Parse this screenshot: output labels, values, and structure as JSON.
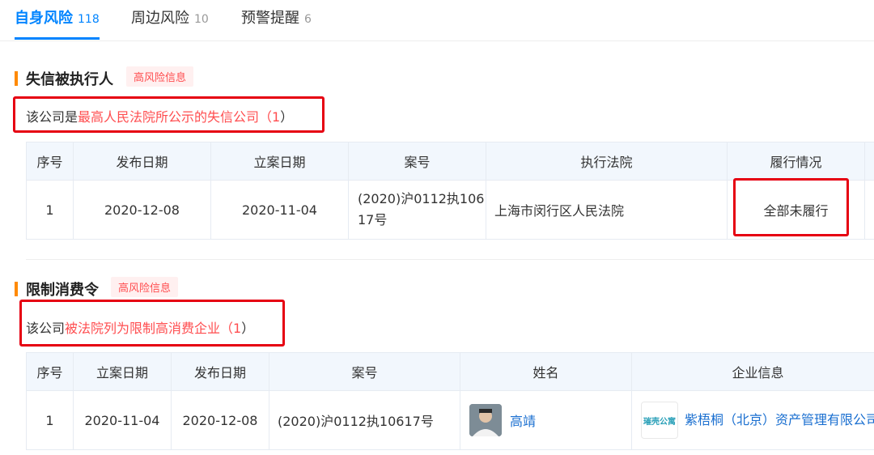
{
  "tabs": [
    {
      "label": "自身风险",
      "count": "118"
    },
    {
      "label": "周边风险",
      "count": "10"
    },
    {
      "label": "预警提醒",
      "count": "6"
    }
  ],
  "section1": {
    "title": "失信被执行人",
    "badge": "高风险信息",
    "intro_prefix": "该公司是",
    "intro_highlight": "最高人民法院所公示的失信公司（",
    "intro_count": "1",
    "intro_suffix": "）",
    "headers": [
      "序号",
      "发布日期",
      "立案日期",
      "案号",
      "执行法院",
      "履行情况"
    ],
    "rows": [
      {
        "no": "1",
        "publish_date": "2020-12-08",
        "filing_date": "2020-11-04",
        "case_no": "(2020)沪0112执10617号",
        "court": "上海市闵行区人民法院",
        "status": "全部未履行"
      }
    ]
  },
  "section2": {
    "title": "限制消费令",
    "badge": "高风险信息",
    "intro_prefix": "该公司",
    "intro_highlight": "被法院列为限制高消费企业（",
    "intro_count": "1",
    "intro_suffix": "）",
    "headers": [
      "序号",
      "立案日期",
      "发布日期",
      "案号",
      "姓名",
      "企业信息"
    ],
    "rows": [
      {
        "no": "1",
        "filing_date": "2020-11-04",
        "publish_date": "2020-12-08",
        "case_no": "(2020)沪0112执10617号",
        "person": "高靖",
        "company": "紫梧桐（北京）资产管理有限公司",
        "logo_text": "璀壳公寓"
      }
    ]
  },
  "colors": {
    "accent": "#0084ff",
    "risk": "#ff4d4f",
    "annotation": "#e60012",
    "section_bar": "#ff8a00"
  }
}
